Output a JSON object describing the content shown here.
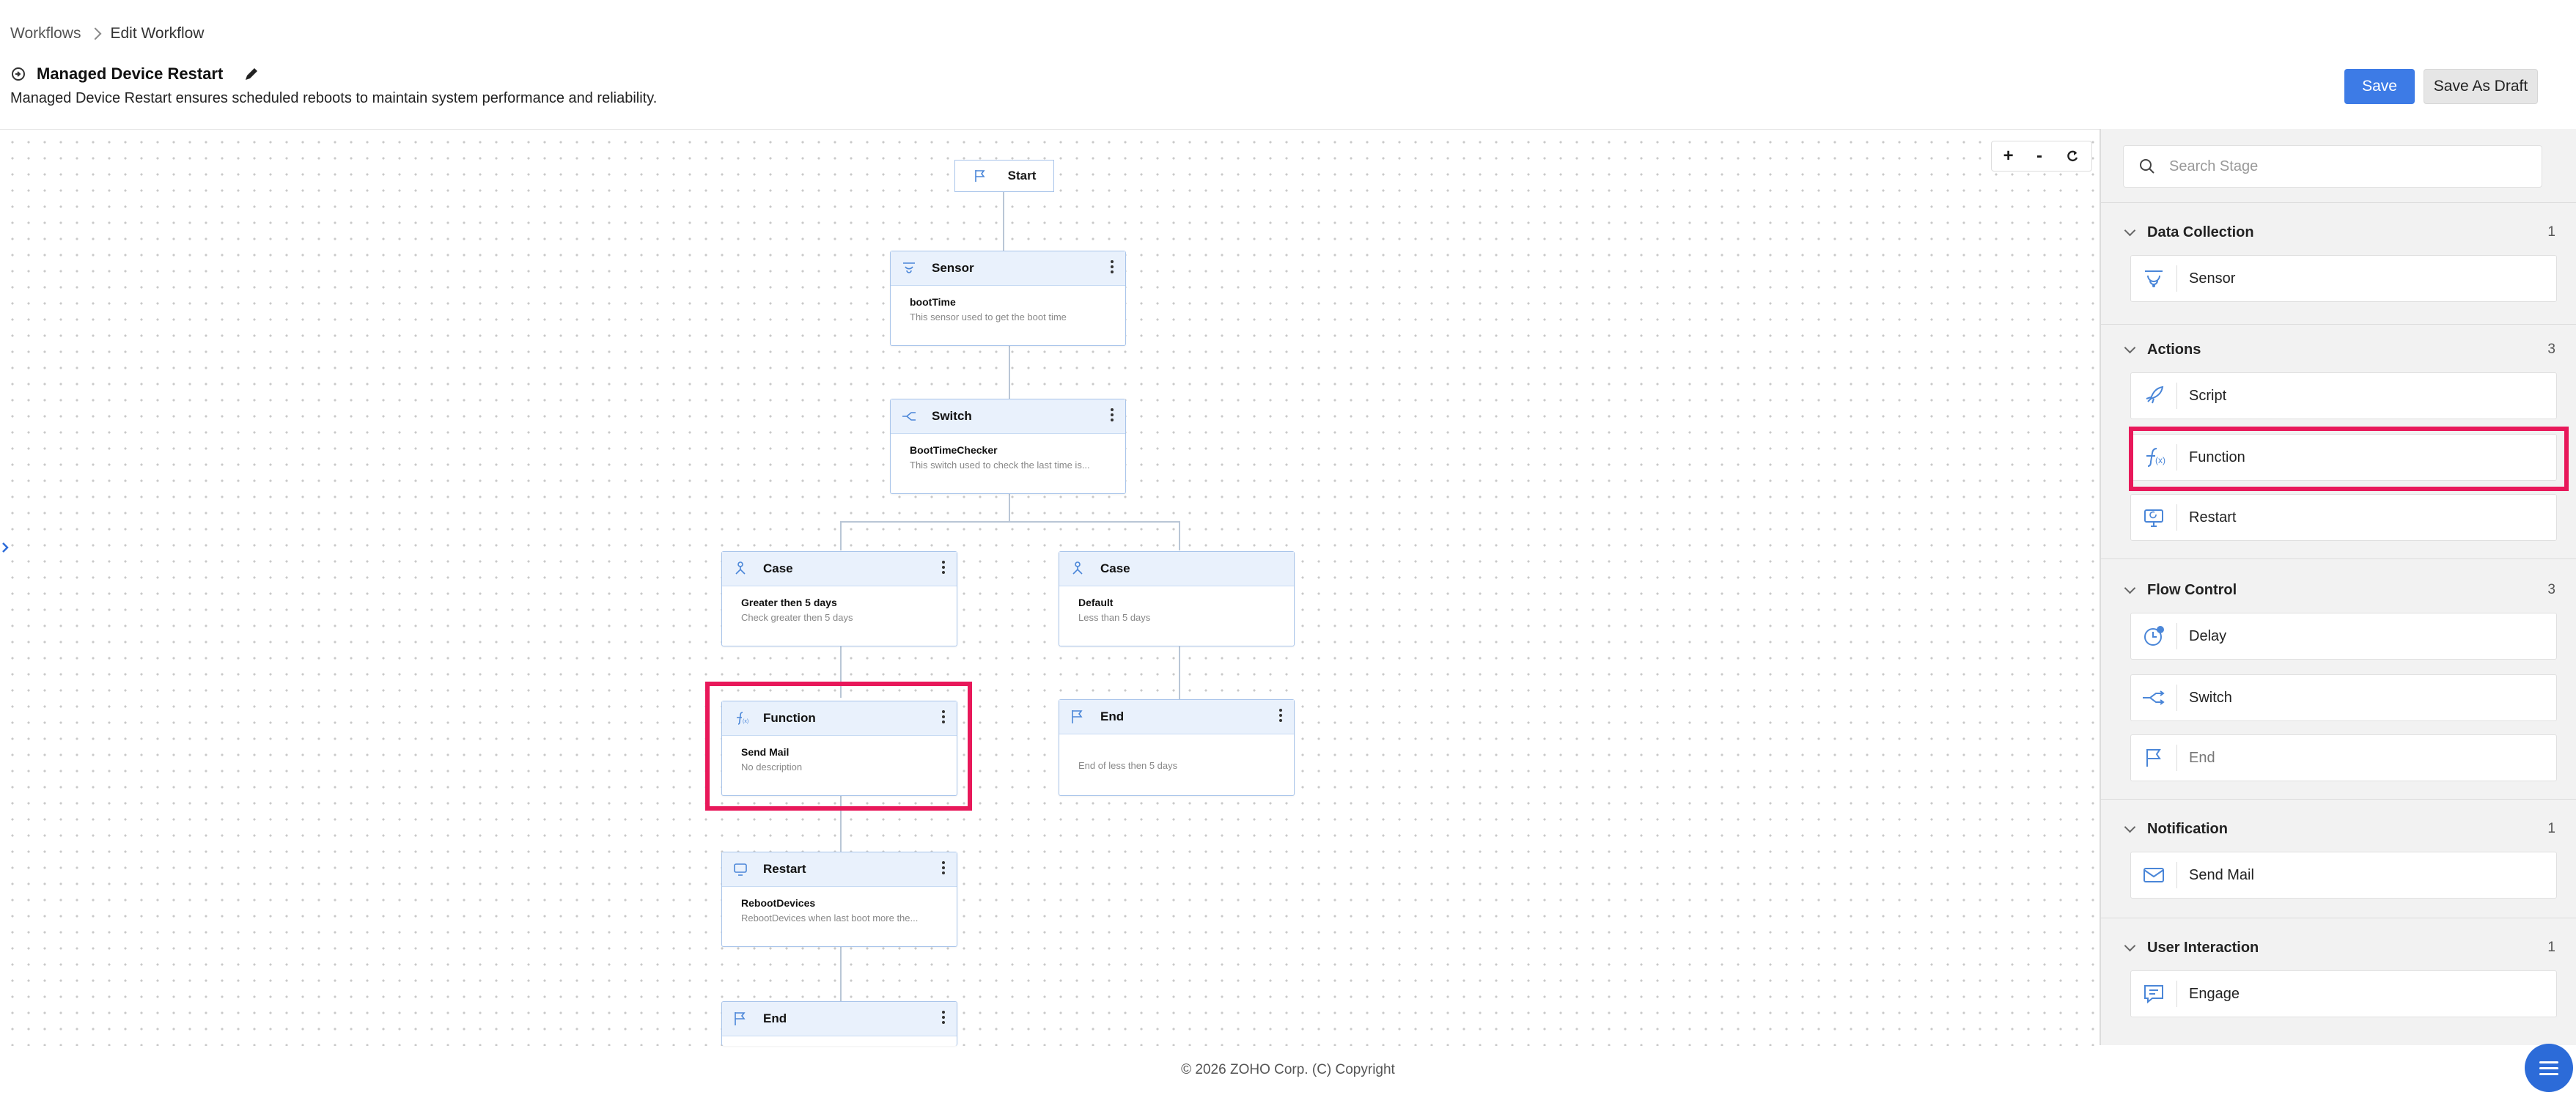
{
  "breadcrumb": {
    "root": "Workflows",
    "current": "Edit Workflow"
  },
  "workflow": {
    "title": "Managed Device Restart",
    "description": "Managed Device Restart ensures scheduled reboots to maintain system performance and reliability."
  },
  "toolbar": {
    "save_label": "Save",
    "draft_label": "Save As Draft"
  },
  "zoom": {
    "in": "+",
    "out": "-"
  },
  "canvas": {
    "start": "Start",
    "nodes": [
      {
        "type": "Sensor",
        "title": "bootTime",
        "desc": "This sensor used to get the boot time"
      },
      {
        "type": "Switch",
        "title": "BootTimeChecker",
        "desc": "This switch used to check the last time is..."
      },
      {
        "type": "Case",
        "title": "Greater then 5 days",
        "desc": "Check greater then 5 days"
      },
      {
        "type": "Case",
        "title": "Default",
        "desc": "Less than 5 days"
      },
      {
        "type": "Function",
        "title": "Send Mail",
        "desc": "No description"
      },
      {
        "type": "End",
        "title": "",
        "desc": "End of less then 5 days"
      },
      {
        "type": "Restart",
        "title": "RebootDevices",
        "desc": "RebootDevices when last boot more the..."
      },
      {
        "type": "End",
        "title": "",
        "desc": ""
      }
    ]
  },
  "panel": {
    "search_placeholder": "Search Stage",
    "categories": [
      {
        "name": "Data Collection",
        "count": "1",
        "items": [
          "Sensor"
        ]
      },
      {
        "name": "Actions",
        "count": "3",
        "items": [
          "Script",
          "Function",
          "Restart"
        ]
      },
      {
        "name": "Flow Control",
        "count": "3",
        "items": [
          "Delay",
          "Switch",
          "End"
        ]
      },
      {
        "name": "Notification",
        "count": "1",
        "items": [
          "Send Mail"
        ]
      },
      {
        "name": "User Interaction",
        "count": "1",
        "items": [
          "Engage"
        ]
      }
    ]
  },
  "footer": {
    "copyright": "© 2026 ZOHO Corp. (C) Copyright"
  },
  "colors": {
    "accent": "#3d7be6",
    "highlight": "#e8185a",
    "node_border": "#a8c4ea",
    "node_head": "#e9f1fc"
  }
}
